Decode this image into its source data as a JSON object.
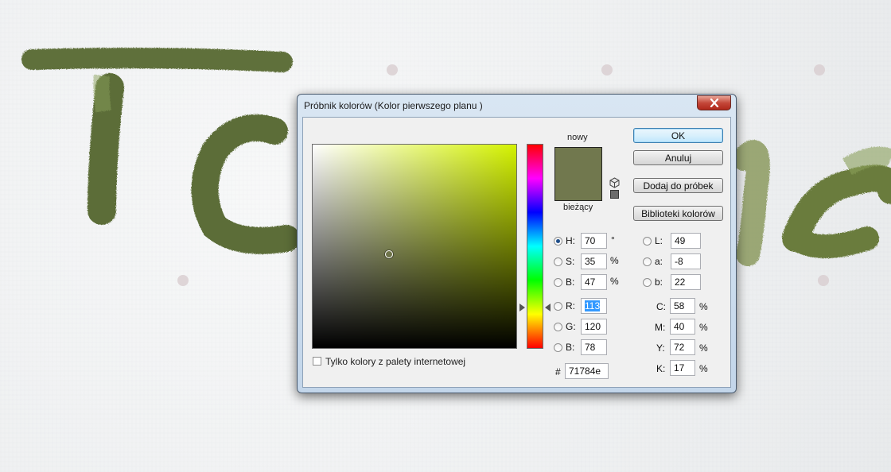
{
  "dialog": {
    "title": "Próbnik kolorów (Kolor pierwszego planu )",
    "close_icon": "close-icon"
  },
  "swatch": {
    "new_label": "nowy",
    "current_label": "bieżący",
    "new_color": "#71784e",
    "current_color": "#71784e"
  },
  "buttons": {
    "ok": "OK",
    "cancel": "Anuluj",
    "add_swatch": "Dodaj do próbek",
    "libraries": "Biblioteki kolorów"
  },
  "hsb": [
    {
      "label": "H:",
      "value": "70",
      "unit": "°",
      "selected": true
    },
    {
      "label": "S:",
      "value": "35",
      "unit": "%"
    },
    {
      "label": "B:",
      "value": "47",
      "unit": "%"
    }
  ],
  "rgb": [
    {
      "label": "R:",
      "value": "113"
    },
    {
      "label": "G:",
      "value": "120"
    },
    {
      "label": "B:",
      "value": "78"
    }
  ],
  "lab": [
    {
      "label": "L:",
      "value": "49"
    },
    {
      "label": "a:",
      "value": "-8"
    },
    {
      "label": "b:",
      "value": "22"
    }
  ],
  "cmyk": [
    {
      "label": "C:",
      "value": "58",
      "unit": "%"
    },
    {
      "label": "M:",
      "value": "40",
      "unit": "%"
    },
    {
      "label": "Y:",
      "value": "72",
      "unit": "%"
    },
    {
      "label": "K:",
      "value": "17",
      "unit": "%"
    }
  ],
  "hex": {
    "symbol": "#",
    "value": "71784e"
  },
  "web_only": {
    "label": "Tylko kolory z palety internetowej",
    "checked": false
  },
  "colors": {
    "field_hue": "#d4f200",
    "paint": "#6b7a45"
  }
}
